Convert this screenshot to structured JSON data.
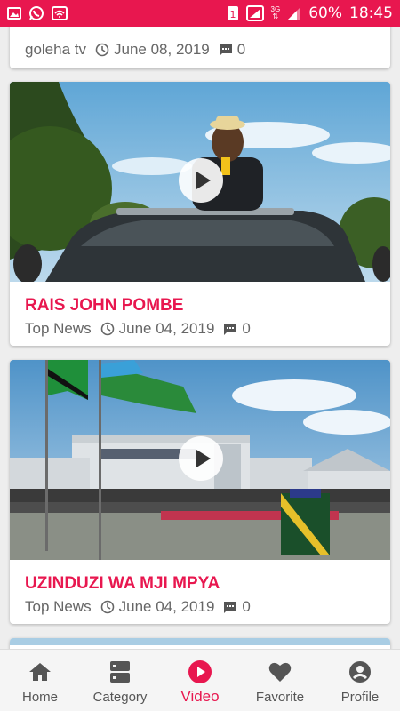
{
  "status_bar": {
    "sim_badge": "1",
    "network": "3G",
    "battery": "60%",
    "time": "18:45",
    "background_color": "#e8174f"
  },
  "feed": {
    "partial_card": {
      "source": "goleha tv",
      "date": "June 08, 2019",
      "comments": "0"
    },
    "cards": [
      {
        "title": "RAIS JOHN POMBE",
        "category": "Top News",
        "date": "June 04, 2019",
        "comments": "0",
        "thumbnail_icon": "play-icon"
      },
      {
        "title": "UZINDUZI WA MJI MPYA",
        "category": "Top News",
        "date": "June 04, 2019",
        "comments": "0",
        "thumbnail_icon": "play-icon"
      }
    ]
  },
  "bottom_nav": {
    "items": [
      {
        "label": "Home",
        "icon": "home-icon"
      },
      {
        "label": "Category",
        "icon": "category-icon"
      },
      {
        "label": "Video",
        "icon": "video-play-icon",
        "active": true
      },
      {
        "label": "Favorite",
        "icon": "heart-icon"
      },
      {
        "label": "Profile",
        "icon": "profile-icon"
      }
    ],
    "active_color": "#e8174f"
  }
}
